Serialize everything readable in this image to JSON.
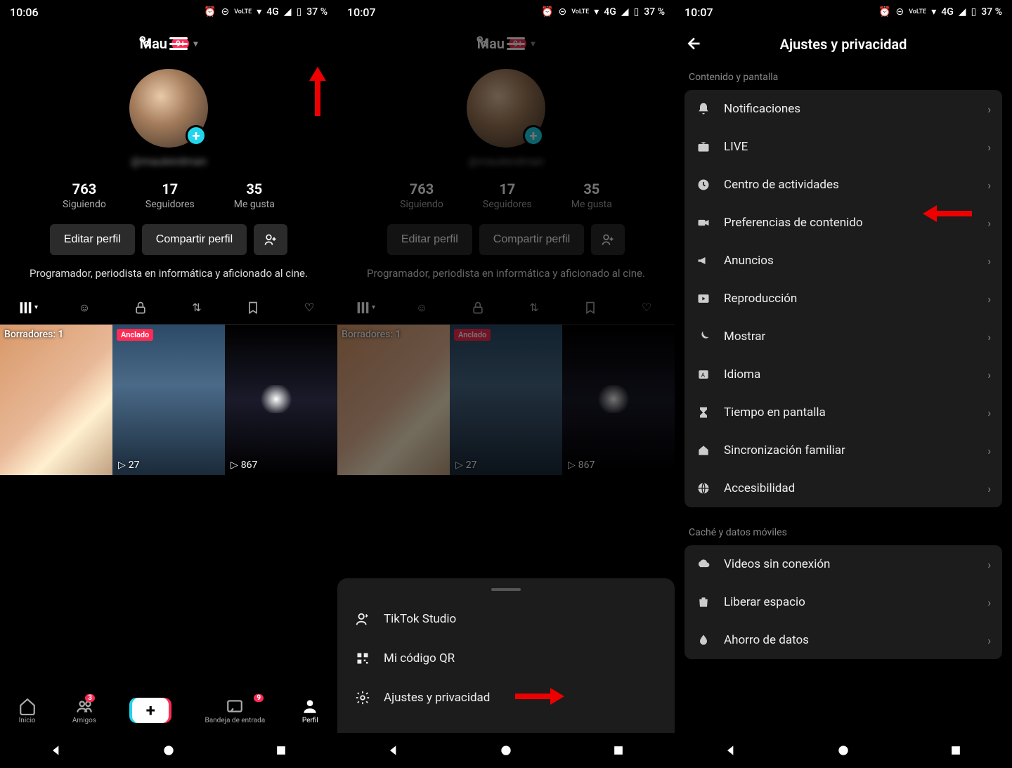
{
  "status": {
    "time1": "10:06",
    "time2": "10:07",
    "time3": "10:07",
    "battery": "37 %",
    "net": "4G"
  },
  "profile": {
    "name": "Mau",
    "badge": "9+",
    "handle": "@mauleirdman",
    "stats": [
      {
        "num": "763",
        "label": "Siguiendo"
      },
      {
        "num": "17",
        "label": "Seguidores"
      },
      {
        "num": "35",
        "label": "Me gusta"
      }
    ],
    "edit": "Editar perfil",
    "share": "Compartir perfil",
    "bio": "Programador, periodista en informática y aficionado al cine."
  },
  "videos": {
    "drafts": "Borradores: 1",
    "pinned": "Anclado",
    "v2views": "27",
    "v3views": "867"
  },
  "bottomnav": {
    "home": "Inicio",
    "friends": "Amigos",
    "friends_badge": "3",
    "inbox": "Bandeja de entrada",
    "inbox_badge": "9",
    "profile": "Perfil"
  },
  "sheet": {
    "studio": "TikTok Studio",
    "qr": "Mi código QR",
    "settings": "Ajustes y privacidad"
  },
  "settings": {
    "title": "Ajustes y privacidad",
    "section1": "Contenido y pantalla",
    "items1": [
      "Notificaciones",
      "LIVE",
      "Centro de actividades",
      "Preferencias de contenido",
      "Anuncios",
      "Reproducción",
      "Mostrar",
      "Idioma",
      "Tiempo en pantalla",
      "Sincronización familiar",
      "Accesibilidad"
    ],
    "section2": "Caché y datos móviles",
    "items2": [
      "Videos sin conexión",
      "Liberar espacio",
      "Ahorro de datos"
    ]
  }
}
